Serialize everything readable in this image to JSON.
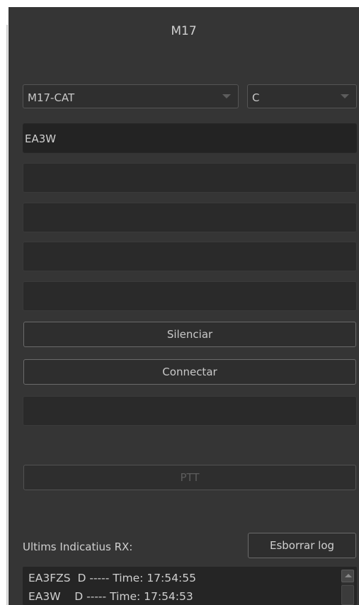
{
  "title": "M17",
  "reflector_select": {
    "value": "M17-CAT"
  },
  "module_select": {
    "value": "C"
  },
  "fields": {
    "callsign": "EA3W",
    "field2": "",
    "field3": "",
    "field4": "",
    "field5": "",
    "field6": ""
  },
  "buttons": {
    "mute": "Silenciar",
    "connect": "Connectar",
    "ptt": "PTT",
    "clear_log": "Esborrar log"
  },
  "rx": {
    "label": "Ultims Indicatius RX:",
    "entries": [
      "EA3FZS  D ----- Time: 17:54:55",
      "EA3W    D ----- Time: 17:54:53"
    ]
  },
  "icons": {
    "dropdown": "chevron-down-icon",
    "scroll_up": "scroll-up-arrow-icon"
  },
  "colors": {
    "background": "#353535",
    "field": "#2a2a2a",
    "text": "#d0d0d0"
  }
}
